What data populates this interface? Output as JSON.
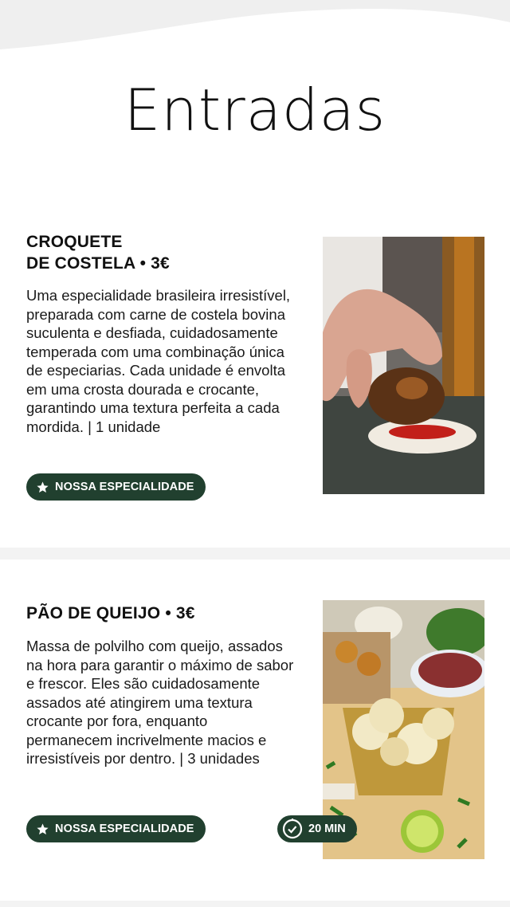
{
  "page": {
    "title": "Entradas"
  },
  "items": [
    {
      "title_line1": "CROQUETE",
      "title_line2": "DE COSTELA • 3€",
      "description": "Uma especialidade brasileira irresistível, preparada com carne de costela bovina suculenta e desfiada, cuidadosamente temperada com uma combinação única de especiarias. Cada unidade é envolta em uma crosta dourada e crocante, garantindo uma textura perfeita a cada mordida. | 1 unidade",
      "badge": "NOSSA ESPECIALIDADE",
      "badge_icon": "star-icon",
      "image": "croquete-photo"
    },
    {
      "title_line1": "PÃO DE QUEIJO • 3€",
      "description": "Massa de polvilho com queijo, assados na hora para garantir o máximo de sabor e frescor. Eles são cuidadosamente assados até atingirem uma textura crocante por fora, enquanto permanecem incrivelmente macios e irresistíveis por dentro. | 3 unidades",
      "badge": "NOSSA ESPECIALIDADE",
      "badge_icon": "star-icon",
      "time": "20 MIN",
      "time_icon": "clock-check-icon",
      "image": "pao-de-queijo-photo"
    }
  ],
  "colors": {
    "badge_bg": "#21402f",
    "background": "#f3f3f3",
    "card": "#ffffff"
  }
}
